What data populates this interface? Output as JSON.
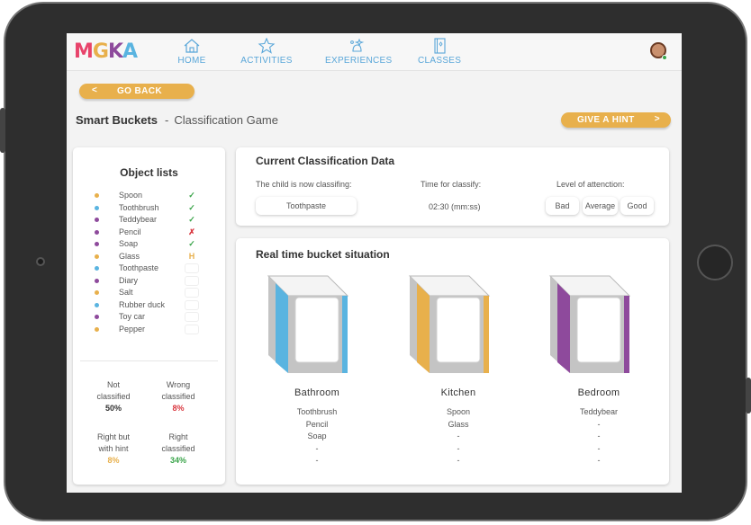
{
  "nav": {
    "logo_letters": [
      "M",
      "G",
      "K",
      "A"
    ],
    "items": [
      {
        "label": "HOME",
        "icon": "home-icon"
      },
      {
        "label": "ACTIVITIES",
        "icon": "star-icon"
      },
      {
        "label": "EXPERIENCES",
        "icon": "sparkles-icon"
      },
      {
        "label": "CLASSES",
        "icon": "book-icon"
      }
    ],
    "color": "#5aa7d9"
  },
  "go_back": {
    "arrow": "<",
    "label": "GO BACK"
  },
  "hint": {
    "label": "GIVE A HINT",
    "arrow": ">"
  },
  "header": {
    "game": "Smart Buckets",
    "separator": "-",
    "subtitle": "Classification Game"
  },
  "objects": {
    "title": "Object lists",
    "items": [
      {
        "name": "Spoon",
        "color": "#e8b04c",
        "mark": "✓",
        "mark_color": "#3aa44a"
      },
      {
        "name": "Toothbrush",
        "color": "#5ab4e0",
        "mark": "✓",
        "mark_color": "#3aa44a"
      },
      {
        "name": "Teddybear",
        "color": "#8e4a9c",
        "mark": "✓",
        "mark_color": "#3aa44a"
      },
      {
        "name": "Pencil",
        "color": "#8e4a9c",
        "mark": "✗",
        "mark_color": "#d9363e"
      },
      {
        "name": "Soap",
        "color": "#8e4a9c",
        "mark": "✓",
        "mark_color": "#3aa44a"
      },
      {
        "name": "Glass",
        "color": "#e8b04c",
        "mark": "H",
        "mark_color": "#e8b04c"
      },
      {
        "name": "Toothpaste",
        "color": "#5ab4e0",
        "mark": "",
        "mark_color": ""
      },
      {
        "name": "Diary",
        "color": "#8e4a9c",
        "mark": "",
        "mark_color": ""
      },
      {
        "name": "Salt",
        "color": "#e8b04c",
        "mark": "",
        "mark_color": ""
      },
      {
        "name": "Rubber duck",
        "color": "#5ab4e0",
        "mark": "",
        "mark_color": ""
      },
      {
        "name": "Toy car",
        "color": "#8e4a9c",
        "mark": "",
        "mark_color": ""
      },
      {
        "name": "Pepper",
        "color": "#e8b04c",
        "mark": "",
        "mark_color": ""
      }
    ],
    "stats": [
      {
        "label1": "Not",
        "label2": "classified",
        "value": "50%",
        "color": "#333333"
      },
      {
        "label1": "Wrong",
        "label2": "classified",
        "value": "8%",
        "color": "#d9363e"
      },
      {
        "label1": "Right but",
        "label2": "with hint",
        "value": "8%",
        "color": "#e8b04c"
      },
      {
        "label1": "Right",
        "label2": "classified",
        "value": "34%",
        "color": "#3aa44a"
      }
    ]
  },
  "current": {
    "title": "Current Classification Data",
    "now_label": "The child is now classifing:",
    "now_value": "Toothpaste",
    "time_label": "Time for classify:",
    "time_value": "02:30 (mm:ss)",
    "attention_label": "Level of attenction:",
    "levels": [
      "Bad",
      "Average",
      "Good"
    ]
  },
  "buckets": {
    "title": "Real time bucket situation",
    "list": [
      {
        "name": "Bathroom",
        "color": "#5ab4e0",
        "items": [
          "Toothbrush",
          "Pencil",
          "Soap",
          "-",
          "-"
        ]
      },
      {
        "name": "Kitchen",
        "color": "#e8b04c",
        "items": [
          "Spoon",
          "Glass",
          "-",
          "-",
          "-"
        ]
      },
      {
        "name": "Bedroom",
        "color": "#8e4a9c",
        "items": [
          "Teddybear",
          "-",
          "-",
          "-",
          "-"
        ]
      }
    ]
  }
}
